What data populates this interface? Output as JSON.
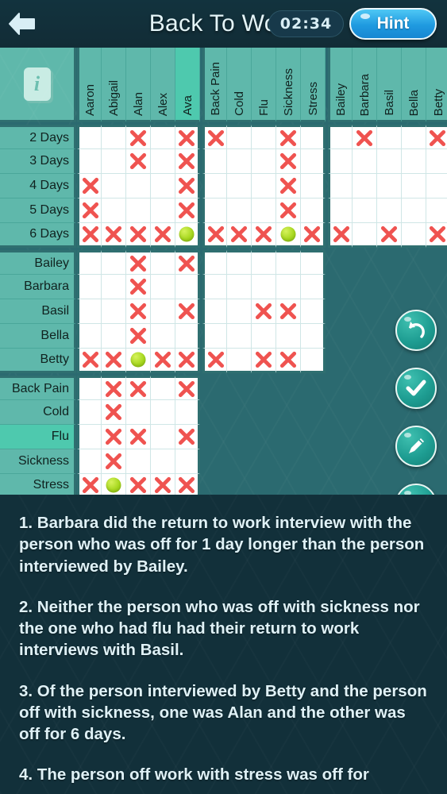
{
  "header": {
    "title": "Back To Work",
    "timer": "02:34",
    "hint_label": "Hint",
    "back_icon": "back-arrow-icon"
  },
  "grid": {
    "info_icon": "info-book-icon",
    "info_glyph": "i",
    "column_groups": [
      {
        "name": "people",
        "columns": [
          "Aaron",
          "Abigail",
          "Alan",
          "Alex",
          "Ava"
        ]
      },
      {
        "name": "reason",
        "columns": [
          "Back Pain",
          "Cold",
          "Flu",
          "Sickness",
          "Stress"
        ]
      },
      {
        "name": "interviewer",
        "columns": [
          "Bailey",
          "Barbara",
          "Basil",
          "Bella",
          "Betty"
        ]
      }
    ],
    "row_groups": [
      {
        "name": "days",
        "rows": [
          "2 Days",
          "3 Days",
          "4 Days",
          "5 Days",
          "6 Days"
        ]
      },
      {
        "name": "interviewer",
        "rows": [
          "Bailey",
          "Barbara",
          "Basil",
          "Bella",
          "Betty"
        ]
      },
      {
        "name": "reason",
        "rows": [
          "Back Pain",
          "Cold",
          "Flu",
          "Sickness",
          "Stress"
        ]
      }
    ],
    "selected_column": "Ava",
    "selected_row": "Flu",
    "blocks": [
      {
        "row_group": "days",
        "col_group": "people",
        "cells": [
          [
            "",
            "",
            "x",
            "",
            "x"
          ],
          [
            "",
            "",
            "x",
            "",
            "x"
          ],
          [
            "x",
            "",
            "",
            "",
            "x"
          ],
          [
            "x",
            "",
            "",
            "",
            "x"
          ],
          [
            "x",
            "x",
            "x",
            "x",
            "o"
          ]
        ]
      },
      {
        "row_group": "days",
        "col_group": "reason",
        "cells": [
          [
            "x",
            "",
            "",
            "x",
            ""
          ],
          [
            "",
            "",
            "",
            "x",
            ""
          ],
          [
            "",
            "",
            "",
            "x",
            ""
          ],
          [
            "",
            "",
            "",
            "x",
            ""
          ],
          [
            "x",
            "x",
            "x",
            "o",
            "x"
          ]
        ]
      },
      {
        "row_group": "days",
        "col_group": "interviewer",
        "cells": [
          [
            "",
            "x",
            "",
            "",
            "x"
          ],
          [
            "",
            "",
            "",
            "",
            ""
          ],
          [
            "",
            "",
            "",
            "",
            ""
          ],
          [
            "",
            "",
            "",
            "",
            ""
          ],
          [
            "x",
            "",
            "x",
            "",
            "x"
          ]
        ]
      },
      {
        "row_group": "interviewer",
        "col_group": "people",
        "cells": [
          [
            "",
            "",
            "x",
            "",
            "x"
          ],
          [
            "",
            "",
            "x",
            "",
            ""
          ],
          [
            "",
            "",
            "x",
            "",
            "x"
          ],
          [
            "",
            "",
            "x",
            "",
            ""
          ],
          [
            "x",
            "x",
            "o",
            "x",
            "x"
          ]
        ]
      },
      {
        "row_group": "interviewer",
        "col_group": "reason",
        "cells": [
          [
            "",
            "",
            "",
            "",
            ""
          ],
          [
            "",
            "",
            "",
            "",
            ""
          ],
          [
            "",
            "",
            "x",
            "x",
            ""
          ],
          [
            "",
            "",
            "",
            "",
            ""
          ],
          [
            "x",
            "",
            "x",
            "x",
            ""
          ]
        ]
      },
      {
        "row_group": "reason",
        "col_group": "people",
        "cells": [
          [
            "",
            "x",
            "x",
            "",
            "x"
          ],
          [
            "",
            "x",
            "",
            "",
            ""
          ],
          [
            "",
            "x",
            "x",
            "",
            "x"
          ],
          [
            "",
            "x",
            "",
            "",
            ""
          ],
          [
            "x",
            "o",
            "x",
            "x",
            "x"
          ]
        ]
      }
    ]
  },
  "actions": [
    {
      "name": "undo-button",
      "icon": "undo-arrow-icon"
    },
    {
      "name": "check-button",
      "icon": "check-mark-icon"
    },
    {
      "name": "pencil-button",
      "icon": "pencil-icon"
    },
    {
      "name": "reset-button",
      "icon": "refresh-icon"
    }
  ],
  "clues": [
    "1. Barbara did the return to work interview with the person who was off for 1 day longer than the person interviewed by Bailey.",
    "2. Neither the person who was off with sickness nor the one who had flu had their return to work interviews with Basil.",
    "3. Of the person interviewed by Betty and the person off with sickness, one was Alan and the other was off for 6 days.",
    "4. The person off work with stress was off for"
  ],
  "colors": {
    "header_bg": "#12303a",
    "grid_header": "#5fb8ab",
    "grid_header_selected": "#4ec9ae",
    "grid_border": "#2f6f70",
    "cell_bg": "#ffffff",
    "mark_x": "#ef5350",
    "mark_o": "#a8d820",
    "hint_blue": "#1f9ae0",
    "panel_teal": "#2b6a70",
    "clue_text": "#dff1f6"
  }
}
